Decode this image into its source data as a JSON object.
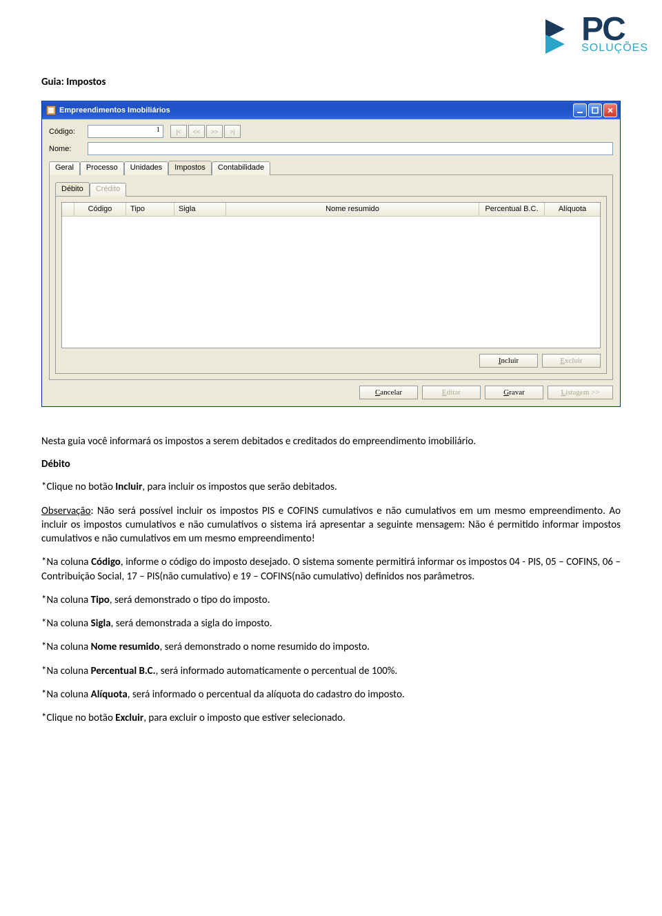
{
  "logo": {
    "main": "PC",
    "sub": "SOLUÇÕES"
  },
  "section_title": "Guia: Impostos",
  "window": {
    "title": "Empreendimentos Imobiliários",
    "codigo_label": "Código:",
    "codigo_value": "1",
    "nome_label": "Nome:",
    "nav": {
      "first": "|<",
      "prev": "<<",
      "next": ">>",
      "last": ">|"
    },
    "tabs": {
      "geral": "Geral",
      "processo": "Processo",
      "unidades": "Unidades",
      "impostos": "Impostos",
      "contabilidade": "Contabilidade"
    },
    "subtabs": {
      "debito": "Débito",
      "credito": "Crédito"
    },
    "grid_headers": {
      "codigo": "Código",
      "tipo": "Tipo",
      "sigla": "Sigla",
      "nome": "Nome resumido",
      "perc": "Percentual B.C.",
      "aliq": "Alíquota"
    },
    "buttons": {
      "incluir": "Incluir",
      "excluir": "Excluir",
      "cancelar": "Cancelar",
      "editar": "Editar",
      "gravar": "Gravar",
      "listagem": "Listagem >>"
    }
  },
  "doc": {
    "p1": "Nesta guia você informará os impostos a serem debitados e creditados do empreendimento imobiliário.",
    "h_debito": "Débito",
    "p2a": "*Clique no botão ",
    "p2b": "Incluir",
    "p2c": ", para incluir os impostos que serão debitados.",
    "p3a": "Observação",
    "p3b": ": Não será possível incluir os impostos PIS e COFINS cumulativos e não cumulativos em um mesmo empreendimento. Ao incluir os impostos cumulativos e não cumulativos o sistema irá apresentar a seguinte mensagem: Não é permitido informar impostos cumulativos e não cumulativos em um mesmo empreendimento!",
    "p4a": "*Na coluna ",
    "p4b": "Código",
    "p4c": ", informe o código do imposto desejado. O sistema somente permitirá informar os impostos 04 - PIS, 05 – COFINS, 06 – Contribuição Social, 17 – PIS(não cumulativo) e 19 – COFINS(não cumulativo) definidos nos parâmetros.",
    "p5a": "*Na coluna ",
    "p5b": "Tipo",
    "p5c": ", será demonstrado o tipo do imposto.",
    "p6a": "*Na coluna ",
    "p6b": "Sigla",
    "p6c": ", será demonstrada a sigla do imposto.",
    "p7a": "*Na coluna ",
    "p7b": "Nome resumido",
    "p7c": ", será demonstrado o nome resumido do imposto.",
    "p8a": "*Na coluna ",
    "p8b": "Percentual B.C.",
    "p8c": ", será informado automaticamente o percentual de 100%.",
    "p9a": "*Na coluna ",
    "p9b": "Alíquota",
    "p9c": ", será informado o percentual da alíquota do cadastro do imposto.",
    "p10a": "*Clique no botão ",
    "p10b": "Excluir",
    "p10c": ", para excluir o imposto que estiver selecionado."
  }
}
